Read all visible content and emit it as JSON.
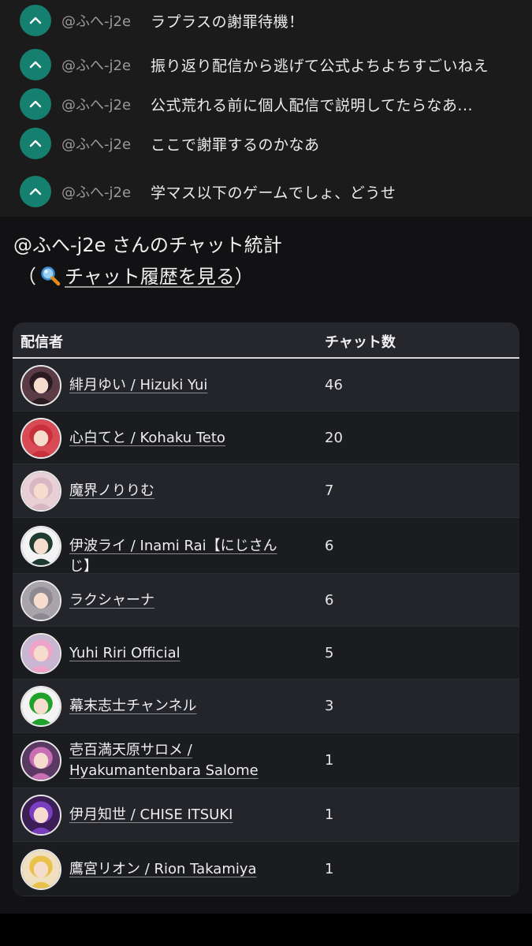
{
  "comments": [
    {
      "user": "@ふへ-j2e",
      "text": "ラプラスの謝罪待機！"
    },
    {
      "user": "@ふへ-j2e",
      "text": "振り返り配信から逃げて公式よちよちすごいねえ"
    },
    {
      "user": "@ふへ-j2e",
      "text": "公式荒れる前に個人配信で説明してたらなあ..."
    },
    {
      "user": "@ふへ-j2e",
      "text": "ここで謝罪するのかなあ"
    },
    {
      "user": "@ふへ-j2e",
      "text": "学マス以下のゲームでしょ、どうせ"
    }
  ],
  "stats": {
    "title": "@ふへ-j2e さんのチャット統計",
    "paren_open": "（",
    "history_link": "チャット履歴を見る",
    "paren_close": "）",
    "magnifier_icon": "magnifier-icon"
  },
  "table": {
    "col_streamer": "配信者",
    "col_count": "チャット数",
    "rows": [
      {
        "name": "緋月ゆい / Hizuki Yui",
        "count": "46",
        "avatar_color": "#5a3b46",
        "hair": "#2a1a22"
      },
      {
        "name": "心白てと / Kohaku Teto",
        "count": "20",
        "avatar_color": "#d84b55",
        "hair": "#c8303c"
      },
      {
        "name": "魔界ノりりむ",
        "count": "7",
        "avatar_color": "#e9cfd6",
        "hair": "#d9b7c2"
      },
      {
        "name": "伊波ライ / Inami Rai【にじさんじ】",
        "count": "6",
        "avatar_color": "#f3f3f3",
        "hair": "#1f3a2e"
      },
      {
        "name": "ラクシャーナ",
        "count": "6",
        "avatar_color": "#a9a4aa",
        "hair": "#8d8892"
      },
      {
        "name": "Yuhi Riri Official",
        "count": "5",
        "avatar_color": "#c8b6d2",
        "hair": "#f0a3c8"
      },
      {
        "name": "幕末志士チャンネル",
        "count": "3",
        "avatar_color": "#f4f4f4",
        "hair": "#1fa22a"
      },
      {
        "name": "壱百満天原サロメ / Hyakumantenbara Salome",
        "count": "1",
        "avatar_color": "#5a3a62",
        "hair": "#c96fb6"
      },
      {
        "name": "伊月知世 / CHISE ITSUKI",
        "count": "1",
        "avatar_color": "#3a1e55",
        "hair": "#7a3fc0"
      },
      {
        "name": "鷹宮リオン / Rion Takamiya",
        "count": "1",
        "avatar_color": "#f1e0c0",
        "hair": "#e8c24a"
      }
    ]
  },
  "colors": {
    "vote_button": "#15806f",
    "background_top": "#1b1b1b",
    "background_stats": "#121214",
    "table_bg": "#1e1f24"
  }
}
